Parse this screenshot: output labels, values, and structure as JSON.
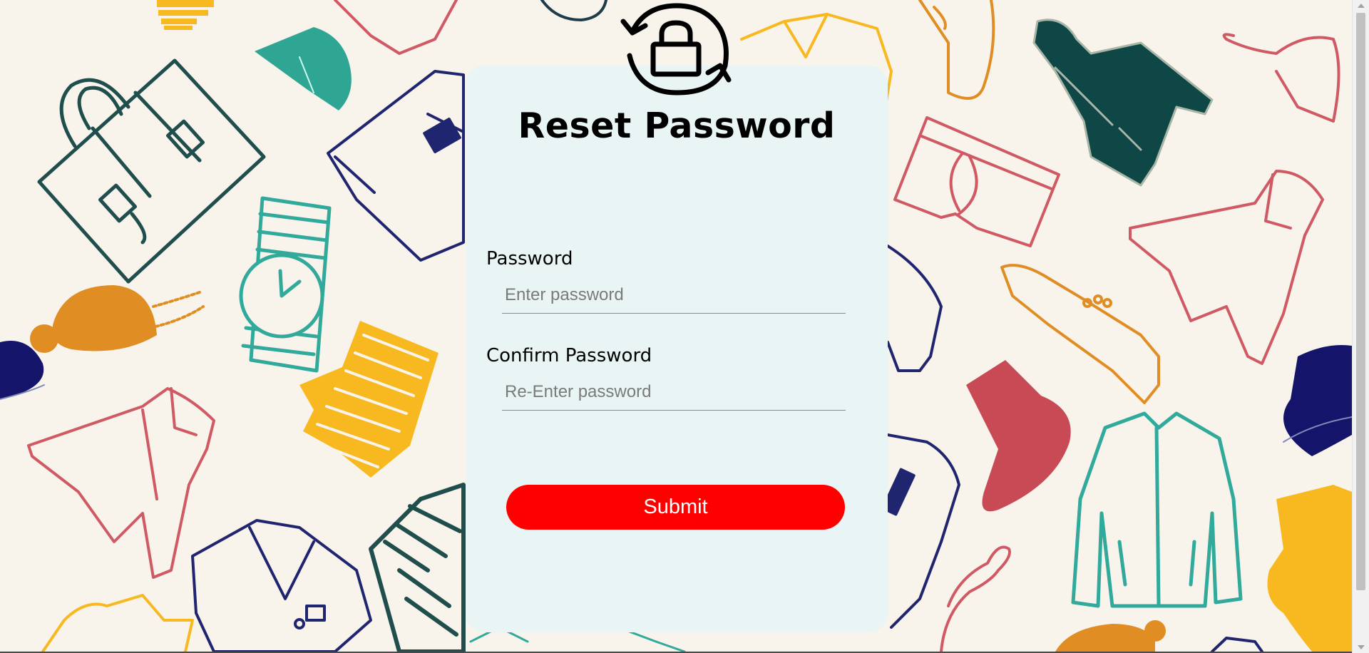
{
  "page": {
    "title": "Reset Password"
  },
  "form": {
    "password_label": "Password",
    "password_placeholder": "Enter password",
    "password_value": "",
    "confirm_label": "Confirm Password",
    "confirm_placeholder": "Re-Enter password",
    "confirm_value": "",
    "submit_label": "Submit"
  },
  "icons": {
    "header_icon": "lock-refresh-icon",
    "background": "clothing-pattern"
  },
  "colors": {
    "card_background": "#e8f5f4",
    "submit_button": "#ff0000",
    "page_background": "#f8f4ec"
  }
}
